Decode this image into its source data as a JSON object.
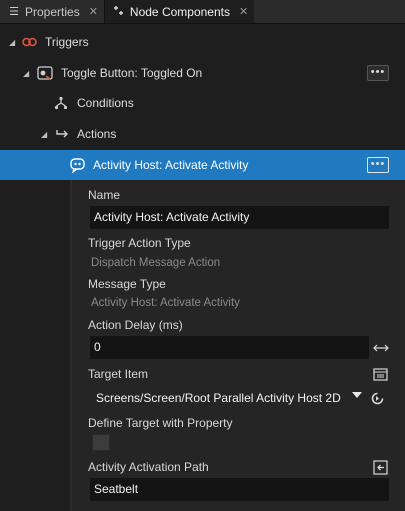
{
  "tabs": [
    {
      "label": "Properties",
      "icon": "list-icon",
      "active": false
    },
    {
      "label": "Node Components",
      "icon": "components-icon",
      "active": true
    }
  ],
  "tree": {
    "triggers": {
      "label": "Triggers",
      "icon": "trigger-icon"
    },
    "toggle_button": {
      "label": "Toggle Button: Toggled On",
      "icon": "toggle-button-icon",
      "menu": "•••"
    },
    "conditions": {
      "label": "Conditions",
      "icon": "conditions-icon"
    },
    "actions": {
      "label": "Actions",
      "icon": "actions-icon"
    },
    "activity_host": {
      "label": "Activity Host: Activate Activity",
      "icon": "activity-icon",
      "menu": "•••",
      "selected": true
    }
  },
  "properties": {
    "name": {
      "label": "Name",
      "value": "Activity Host: Activate Activity"
    },
    "trigger_action_type": {
      "label": "Trigger Action Type",
      "value": "Dispatch Message Action"
    },
    "message_type": {
      "label": "Message Type",
      "value": "Activity Host: Activate Activity"
    },
    "action_delay": {
      "label": "Action Delay (ms)",
      "value": "0"
    },
    "target_item": {
      "label": "Target Item",
      "value": "Screens/Screen/Root Parallel Activity Host 2D"
    },
    "define_target": {
      "label": "Define Target with Property",
      "checked": false
    },
    "activation_path": {
      "label": "Activity Activation Path",
      "value": "Seatbelt"
    }
  },
  "colors": {
    "background": "#1e1e1e",
    "selection": "#1f7ac2",
    "panel": "#252525",
    "field": "#141414",
    "trigger_icon": "#e0533f"
  }
}
